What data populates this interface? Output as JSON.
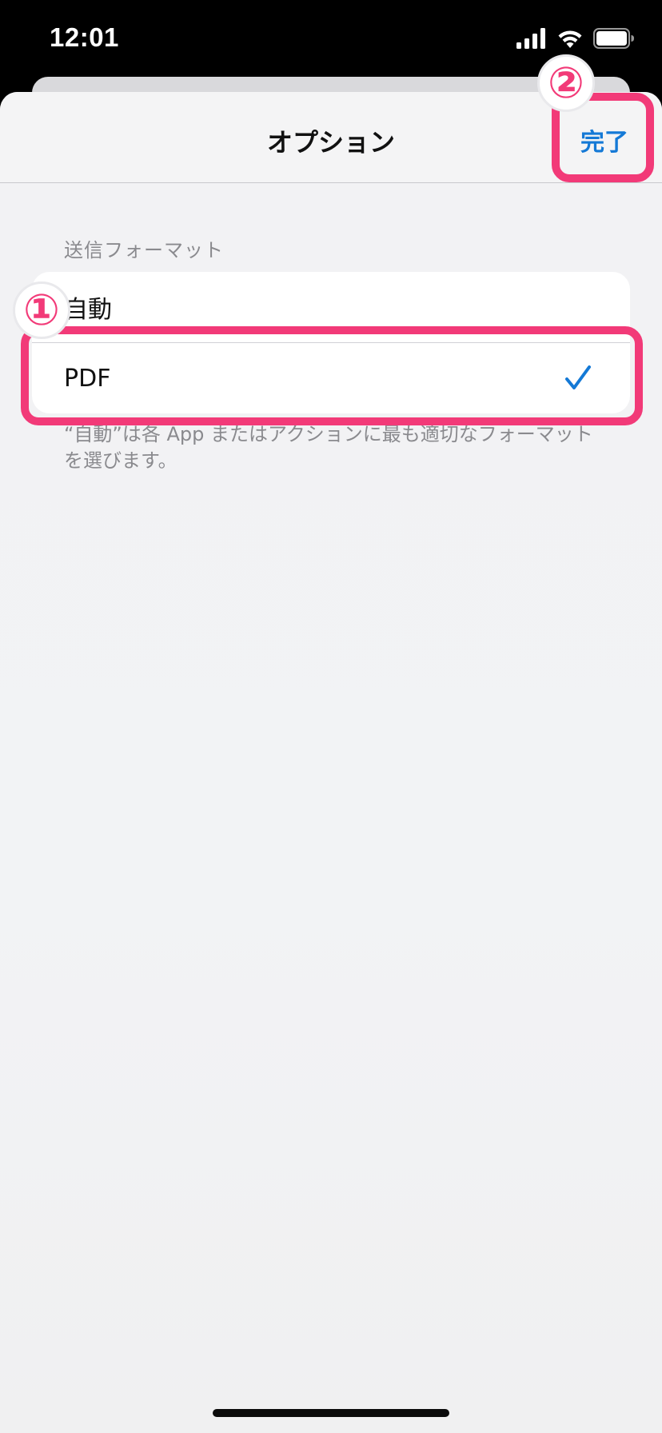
{
  "status_bar": {
    "time": "12:01"
  },
  "sheet": {
    "title": "オプション",
    "done_label": "完了",
    "section_header": "送信フォーマット",
    "options": [
      {
        "label": "自動",
        "selected": false
      },
      {
        "label": "PDF",
        "selected": true
      }
    ],
    "footer_note": "“自動”は各 App またはアクションに最も適切なフォーマットを選びます。"
  },
  "annotations": {
    "badge_1": "①",
    "badge_2": "②",
    "color": "#f23a78"
  },
  "colors": {
    "accent": "#1479d6",
    "annotation": "#f23a78"
  },
  "icons": [
    "signal-icon",
    "wifi-icon",
    "battery-icon",
    "checkmark-icon"
  ]
}
